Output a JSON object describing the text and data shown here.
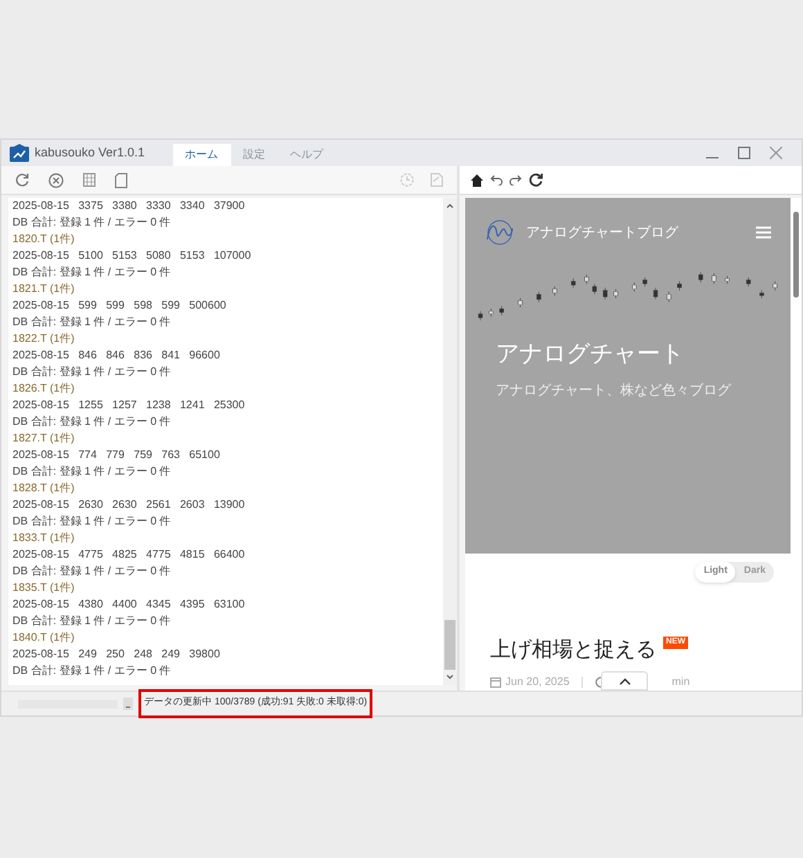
{
  "window": {
    "title": "kabusouko Ver1.0.1"
  },
  "tabs": [
    {
      "label": "ホーム",
      "selected": true
    },
    {
      "label": "設定",
      "selected": false
    },
    {
      "label": "ヘルプ",
      "selected": false
    }
  ],
  "log": [
    {
      "kind": "price",
      "text": "2025-08-15   3375   3380   3330   3340   37900"
    },
    {
      "kind": "db",
      "text": "DB 合計: 登録 1 件 / エラー 0 件"
    },
    {
      "kind": "code",
      "text": "1820.T (1件)"
    },
    {
      "kind": "price",
      "text": "2025-08-15   5100   5153   5080   5153   107000"
    },
    {
      "kind": "db",
      "text": "DB 合計: 登録 1 件 / エラー 0 件"
    },
    {
      "kind": "code",
      "text": "1821.T (1件)"
    },
    {
      "kind": "price",
      "text": "2025-08-15   599   599   598   599   500600"
    },
    {
      "kind": "db",
      "text": "DB 合計: 登録 1 件 / エラー 0 件"
    },
    {
      "kind": "code",
      "text": "1822.T (1件)"
    },
    {
      "kind": "price",
      "text": "2025-08-15   846   846   836   841   96600"
    },
    {
      "kind": "db",
      "text": "DB 合計: 登録 1 件 / エラー 0 件"
    },
    {
      "kind": "code",
      "text": "1826.T (1件)"
    },
    {
      "kind": "price",
      "text": "2025-08-15   1255   1257   1238   1241   25300"
    },
    {
      "kind": "db",
      "text": "DB 合計: 登録 1 件 / エラー 0 件"
    },
    {
      "kind": "code",
      "text": "1827.T (1件)"
    },
    {
      "kind": "price",
      "text": "2025-08-15   774   779   759   763   65100"
    },
    {
      "kind": "db",
      "text": "DB 合計: 登録 1 件 / エラー 0 件"
    },
    {
      "kind": "code",
      "text": "1828.T (1件)"
    },
    {
      "kind": "price",
      "text": "2025-08-15   2630   2630   2561   2603   13900"
    },
    {
      "kind": "db",
      "text": "DB 合計: 登録 1 件 / エラー 0 件"
    },
    {
      "kind": "code",
      "text": "1833.T (1件)"
    },
    {
      "kind": "price",
      "text": "2025-08-15   4775   4825   4775   4815   66400"
    },
    {
      "kind": "db",
      "text": "DB 合計: 登録 1 件 / エラー 0 件"
    },
    {
      "kind": "code",
      "text": "1835.T (1件)"
    },
    {
      "kind": "price",
      "text": "2025-08-15   4380   4400   4345   4395   63100"
    },
    {
      "kind": "db",
      "text": "DB 合計: 登録 1 件 / エラー 0 件"
    },
    {
      "kind": "code",
      "text": "1840.T (1件)"
    },
    {
      "kind": "price",
      "text": "2025-08-15   249   250   248   249   39800"
    },
    {
      "kind": "db",
      "text": "DB 合計: 登録 1 件 / エラー 0 件"
    }
  ],
  "browser": {
    "site_name": "アナログチャートブログ",
    "hero_title": "アナログチャート",
    "hero_subtitle": "アナログチャート、株など色々ブログ",
    "theme_toggle": [
      {
        "label": "Light",
        "selected": true
      },
      {
        "label": "Dark",
        "selected": false
      }
    ],
    "post": {
      "title": "上げ相場と捉える",
      "badge": "NEW",
      "date": "Jun 20, 2025",
      "read_time": "min"
    }
  },
  "status_bar": {
    "level": 0,
    "text": "データの更新中 100/3789 (成功:91 失敗:0 未取得:0)",
    "highlighted": true
  }
}
